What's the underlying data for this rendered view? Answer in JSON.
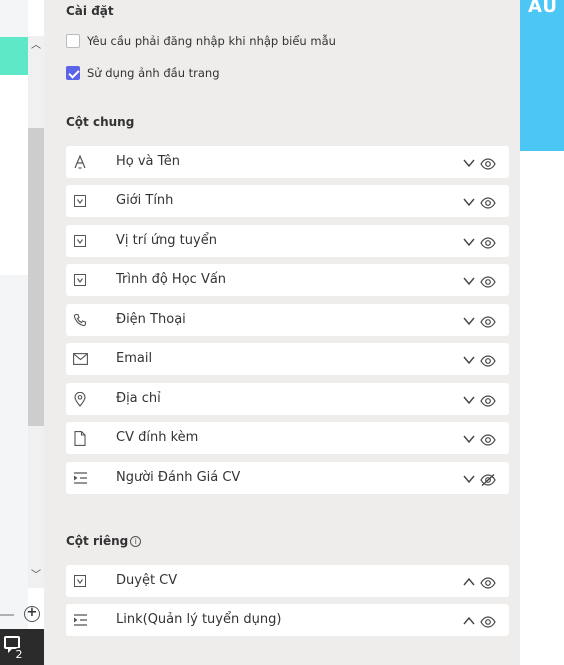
{
  "settings": {
    "title": "Cài đặt",
    "require_login_label": "Yêu cầu phải đăng nhập khi nhập biểu mẫu",
    "require_login_checked": false,
    "use_header_image_label": "Sử dụng ảnh đầu trang",
    "use_header_image_checked": true
  },
  "common_columns": {
    "title": "Cột chung",
    "items": [
      {
        "label": "Họ và Tên",
        "icon": "text-icon",
        "chevron": "down",
        "visible": true
      },
      {
        "label": "Giới Tính",
        "icon": "dropdown-icon",
        "chevron": "down",
        "visible": true
      },
      {
        "label": "Vị trí ứng tuyển",
        "icon": "dropdown-icon",
        "chevron": "down",
        "visible": true
      },
      {
        "label": "Trình độ Học Vấn",
        "icon": "dropdown-icon",
        "chevron": "down",
        "visible": true
      },
      {
        "label": "Điện Thoại",
        "icon": "phone-icon",
        "chevron": "down",
        "visible": true
      },
      {
        "label": "Email",
        "icon": "mail-icon",
        "chevron": "down",
        "visible": true
      },
      {
        "label": "Địa chỉ",
        "icon": "location-icon",
        "chevron": "down",
        "visible": true
      },
      {
        "label": "CV đính kèm",
        "icon": "file-icon",
        "chevron": "down",
        "visible": true
      },
      {
        "label": "Người Đánh Giá CV",
        "icon": "assign-icon",
        "chevron": "down",
        "visible": false
      }
    ]
  },
  "private_columns": {
    "title": "Cột riêng",
    "info_icon": "info-icon",
    "items": [
      {
        "label": "Duyệt CV",
        "icon": "dropdown-icon",
        "chevron": "up",
        "visible": true
      },
      {
        "label": "Link(Quản lý tuyển dụng)",
        "icon": "assign-icon",
        "chevron": "up",
        "visible": true
      }
    ]
  },
  "background": {
    "right_banner_text": "AU",
    "comment_count": "2"
  },
  "colors": {
    "panel_bg": "#eeedec",
    "checkbox_checked": "#5b63e6",
    "right_banner": "#4cc6f5",
    "left_teal": "#5fe8c7"
  }
}
